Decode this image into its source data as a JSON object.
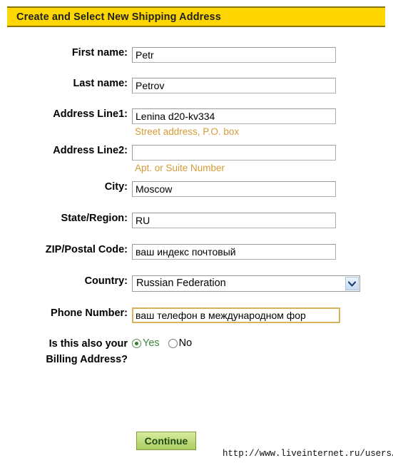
{
  "header": {
    "title": "Create and Select New Shipping Address",
    "bg_color": "#FFD700",
    "border_color": "#8a7300"
  },
  "form": {
    "fields": [
      {
        "name": "first-name",
        "label": "First name:",
        "value": "Petr",
        "placeholder": "",
        "hint": "",
        "type": "text",
        "focused": false
      },
      {
        "name": "last-name",
        "label": "Last name:",
        "value": "Petrov",
        "placeholder": "",
        "hint": "",
        "type": "text",
        "focused": false
      },
      {
        "name": "address-line1",
        "label": "Address Line1:",
        "value": "Lenina d20-kv334",
        "placeholder": "",
        "hint": "Street address, P.O. box",
        "type": "text",
        "focused": false
      },
      {
        "name": "address-line2",
        "label": "Address Line2:",
        "value": "",
        "placeholder": "",
        "hint": "Apt. or Suite Number",
        "type": "text",
        "focused": false
      },
      {
        "name": "city",
        "label": "City:",
        "value": "Moscow",
        "placeholder": "",
        "hint": "",
        "type": "text",
        "focused": false
      },
      {
        "name": "state-region",
        "label": "State/Region:",
        "value": "RU",
        "placeholder": "",
        "hint": "",
        "type": "text",
        "focused": false
      },
      {
        "name": "zip-postal-code",
        "label": "ZIP/Postal Code:",
        "value": "ваш индекс почтовый",
        "placeholder": "",
        "hint": "",
        "type": "text",
        "focused": false
      }
    ],
    "country": {
      "label": "Country:",
      "selected": "Russian Federation",
      "options": [
        "Russian Federation"
      ],
      "icon": "chevron-down-icon"
    },
    "phone": {
      "label": "Phone Number:",
      "value": "ваш телефон в международном фор",
      "focused": true,
      "focus_border_color": "#d8b35a"
    },
    "billing": {
      "label_line1": "Is this also your",
      "label_line2": "Billing Address?",
      "options": [
        {
          "label": "Yes",
          "checked": true
        },
        {
          "label": "No",
          "checked": false
        }
      ],
      "selected_color": "#3e8a3e"
    },
    "hint_color": "#D49A37"
  },
  "actions": {
    "continue_label": "Continue",
    "continue_bg_top": "#d8ec9e",
    "continue_bg_bottom": "#aacd62",
    "continue_text_color": "#1f4a13"
  },
  "watermark": {
    "url": "http://www.liveinternet.ru/users/slimq/"
  }
}
